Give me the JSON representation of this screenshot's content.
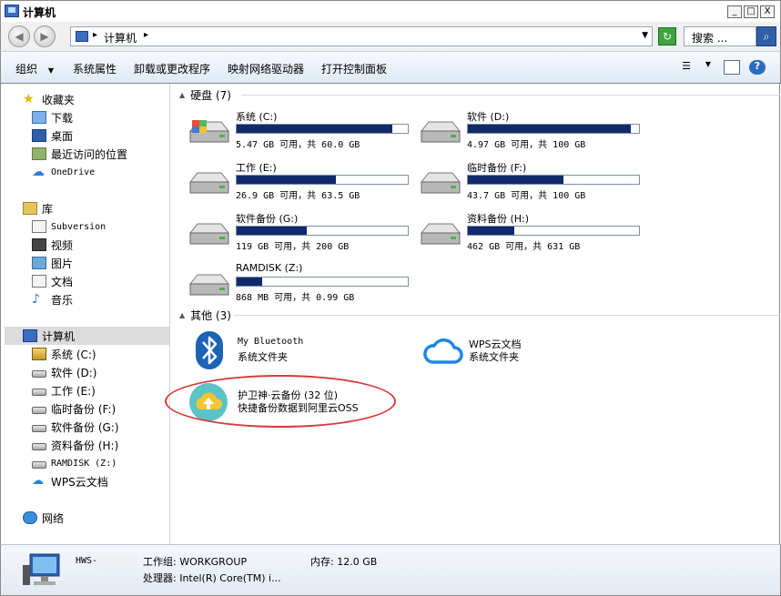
{
  "window": {
    "title": "计算机",
    "controls": [
      "_",
      "□",
      "X"
    ]
  },
  "address": {
    "path": "计算机",
    "search_placeholder": "搜索 ..."
  },
  "toolbar": {
    "organize": "组织",
    "system_properties": "系统属性",
    "uninstall": "卸载或更改程序",
    "map_drive": "映射网络驱动器",
    "control_panel": "打开控制面板"
  },
  "sidebar": {
    "favorites": {
      "label": "收藏夹",
      "items": [
        "下载",
        "桌面",
        "最近访问的位置",
        "OneDrive"
      ]
    },
    "libraries": {
      "label": "库",
      "items": [
        "Subversion",
        "视频",
        "图片",
        "文档",
        "音乐"
      ]
    },
    "computer": {
      "label": "计算机",
      "items": [
        "系统 (C:)",
        "软件 (D:)",
        "工作 (E:)",
        "临时备份 (F:)",
        "软件备份 (G:)",
        "资料备份 (H:)",
        "RAMDISK (Z:)",
        "WPS云文档"
      ]
    },
    "network": {
      "label": "网络"
    }
  },
  "content": {
    "hard_disks": {
      "title": "硬盘 (7)",
      "drives": [
        {
          "name": "系统 (C:)",
          "size": "5.47 GB 可用，共 60.0 GB",
          "used_fraction": 0.91
        },
        {
          "name": "软件 (D:)",
          "size": "4.97 GB 可用，共 100 GB",
          "used_fraction": 0.95
        },
        {
          "name": "工作 (E:)",
          "size": "26.9 GB 可用，共 63.5 GB",
          "used_fraction": 0.58
        },
        {
          "name": "临时备份 (F:)",
          "size": "43.7 GB 可用，共 100 GB",
          "used_fraction": 0.56
        },
        {
          "name": "软件备份 (G:)",
          "size": "119 GB 可用，共 200 GB",
          "used_fraction": 0.41
        },
        {
          "name": "资料备份 (H:)",
          "size": "462 GB 可用，共 631 GB",
          "used_fraction": 0.27
        },
        {
          "name": "RAMDISK (Z:)",
          "size": "868 MB 可用，共 0.99 GB",
          "used_fraction": 0.15
        }
      ]
    },
    "other": {
      "title": "其他 (3)",
      "items": [
        {
          "name": "My Bluetooth",
          "desc": "系统文件夹"
        },
        {
          "name": "WPS云文档",
          "desc": "系统文件夹"
        },
        {
          "name": "护卫神·云备份 (32 位)",
          "desc": "快捷备份数据到阿里云OSS"
        }
      ]
    }
  },
  "details": {
    "name_prefix": "HWS-",
    "workgroup": "工作组: WORKGROUP",
    "memory": "内存: 12.0 GB",
    "processor": "处理器: Intel(R) Core(TM) i..."
  },
  "colors": {
    "drive_fill": "#122a6b",
    "highlight_ring": "#d63a3a",
    "bluetooth": "#1c62b5",
    "wps_cloud": "#1f86e0",
    "backup_icon_bg": "#5bc3c7",
    "backup_icon_cloud": "#f2c630"
  }
}
